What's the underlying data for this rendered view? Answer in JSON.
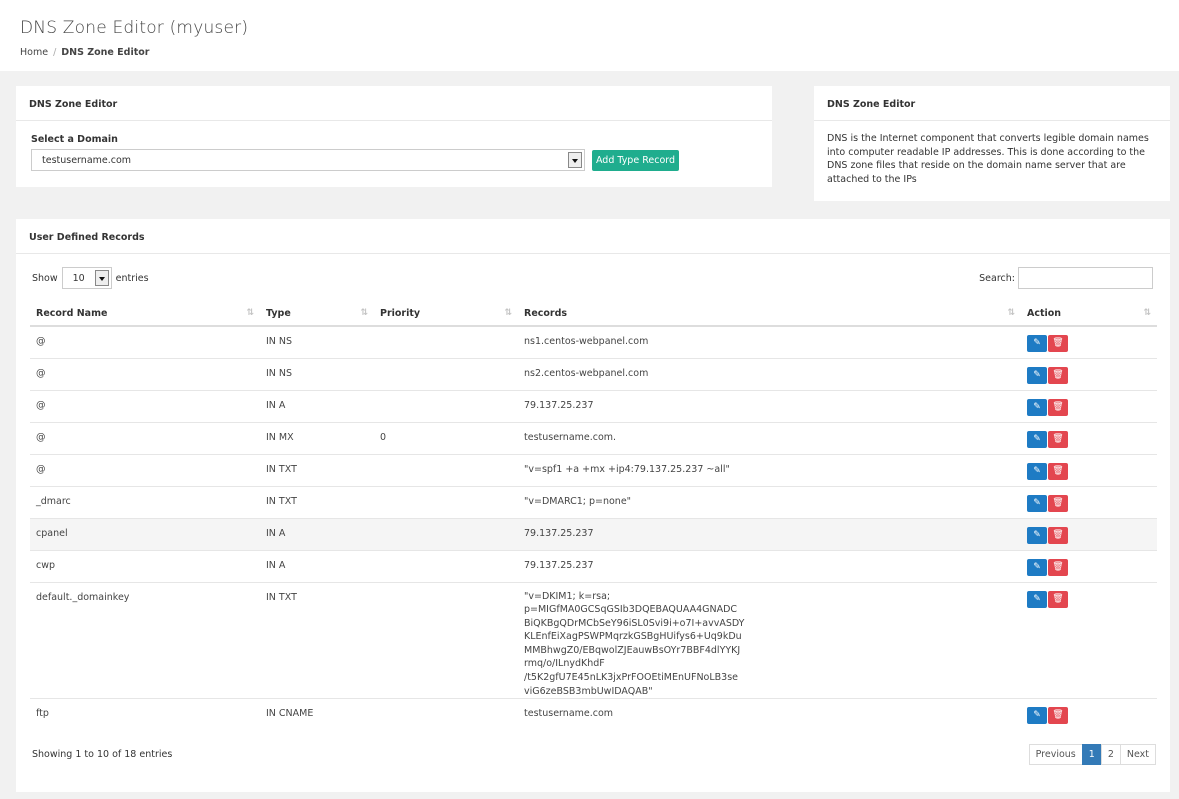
{
  "page": {
    "title": "DNS Zone Editor (myuser)",
    "breadcrumb": {
      "home": "Home",
      "separator": "/",
      "current": "DNS Zone Editor"
    }
  },
  "select_panel": {
    "heading": "DNS Zone Editor",
    "label": "Select a Domain",
    "selected_domain": "testusername.com",
    "add_button": "Add Type Record"
  },
  "info_panel": {
    "heading": "DNS Zone Editor",
    "text": "DNS is the Internet component that converts legible domain names into computer readable IP addresses. This is done according to the DNS zone files that reside on the domain name server that are attached to the IPs"
  },
  "records_panel": {
    "heading": "User Defined Records",
    "show_label": "Show",
    "page_length": "10",
    "entries_label": "entries",
    "search_label": "Search:",
    "columns": [
      "Record Name",
      "Type",
      "Priority",
      "Records",
      "Action"
    ],
    "rows": [
      {
        "name": "@",
        "type": "IN NS",
        "priority": "",
        "record": "ns1.centos-webpanel.com"
      },
      {
        "name": "@",
        "type": "IN NS",
        "priority": "",
        "record": "ns2.centos-webpanel.com"
      },
      {
        "name": "@",
        "type": "IN A",
        "priority": "",
        "record": "79.137.25.237"
      },
      {
        "name": "@",
        "type": "IN MX",
        "priority": "0",
        "record": "testusername.com."
      },
      {
        "name": "@",
        "type": "IN TXT",
        "priority": "",
        "record": "\"v=spf1 +a +mx +ip4:79.137.25.237 ~all\""
      },
      {
        "name": "_dmarc",
        "type": "IN TXT",
        "priority": "",
        "record": "\"v=DMARC1; p=none\""
      },
      {
        "name": "cpanel",
        "type": "IN A",
        "priority": "",
        "record": "79.137.25.237"
      },
      {
        "name": "cwp",
        "type": "IN A",
        "priority": "",
        "record": "79.137.25.237"
      },
      {
        "name": "default._domainkey",
        "type": "IN TXT",
        "priority": "",
        "record_lines": [
          "\"v=DKIM1; k=rsa;",
          "p=MIGfMA0GCSqGSIb3DQEBAQUAA4GNADC",
          "BiQKBgQDrMCbSeY96iSL0Svi9i+o7I+avvASDY",
          "KLEnfEiXagPSWPMqrzkGSBgHUifys6+Uq9kDu",
          "MMBhwgZ0/EBqwolZJEauwBsOYr7BBF4dlYYKJ",
          "rmq/o/ILnydKhdF",
          "/t5K2gfU7E45nLK3jxPrFOOEtiMEnUFNoLB3se",
          "viG6zeBSB3mbUwIDAQAB\""
        ]
      },
      {
        "name": "ftp",
        "type": "IN CNAME",
        "priority": "",
        "record": "testusername.com"
      }
    ],
    "info": "Showing 1 to 10 of 18 entries",
    "pagination": {
      "previous": "Previous",
      "pages": [
        "1",
        "2"
      ],
      "current": "1",
      "next": "Next"
    }
  },
  "icons": {
    "edit": "edit-icon",
    "delete": "trash-icon",
    "sort": "sort-icon",
    "dropdown": "chevron-down-icon"
  },
  "colors": {
    "add_button": "#1fad8e",
    "edit_button": "#1e7bc4",
    "delete_button": "#e3464f",
    "pager_active": "#337ab7"
  }
}
